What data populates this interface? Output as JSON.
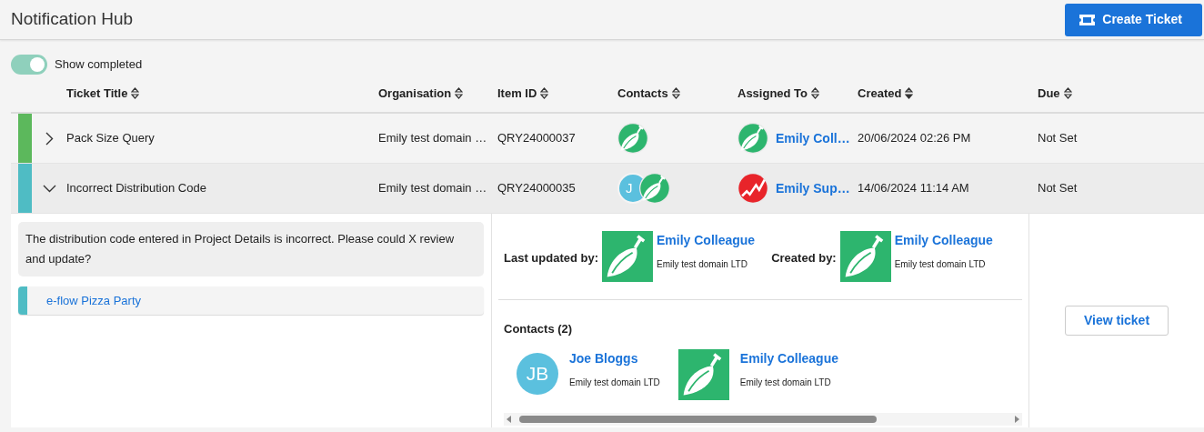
{
  "header": {
    "title": "Notification Hub",
    "create_button": "Create Ticket"
  },
  "toggle": {
    "label": "Show completed",
    "on": true
  },
  "table": {
    "columns": [
      {
        "label": "Ticket Title",
        "sorted": false
      },
      {
        "label": "Organisation",
        "sorted": false
      },
      {
        "label": "Item ID",
        "sorted": false
      },
      {
        "label": "Contacts",
        "sorted": false
      },
      {
        "label": "Assigned To",
        "sorted": false
      },
      {
        "label": "Created",
        "sorted": true
      },
      {
        "label": "Due",
        "sorted": false
      }
    ],
    "rows": [
      {
        "color": "#5cb85c",
        "expanded": false,
        "title": "Pack Size Query",
        "organisation": "Emily test domain …",
        "item_id": "QRY24000037",
        "contacts": [
          {
            "kind": "leaf"
          }
        ],
        "assigned": {
          "kind": "leaf",
          "name": "Emily Coll…"
        },
        "created": "20/06/2024 02:26 PM",
        "due": "Not Set"
      },
      {
        "color": "#4fbcc4",
        "expanded": true,
        "title": "Incorrect Distribution Code",
        "organisation": "Emily test domain …",
        "item_id": "QRY24000035",
        "contacts": [
          {
            "kind": "initials",
            "initials": "J"
          },
          {
            "kind": "leaf"
          }
        ],
        "assigned": {
          "kind": "chart",
          "name": "Emily Sup…"
        },
        "created": "14/06/2024 11:14 AM",
        "due": "Not Set"
      }
    ]
  },
  "detail": {
    "description": "The distribution code entered in Project Details is incorrect. Please could X review and update?",
    "linked_item": {
      "label": "e-flow Pizza Party",
      "color": "#4fbcc4"
    },
    "people": [
      {
        "label": "Last updated by:",
        "name": "Emily Colleague",
        "organisation": "Emily test domain LTD",
        "kind": "leaf"
      },
      {
        "label": "Created by:",
        "name": "Emily Colleague",
        "organisation": "Emily test domain LTD",
        "kind": "leaf"
      }
    ],
    "contacts_heading": "Contacts (2)",
    "contacts": [
      {
        "kind": "initials",
        "initials": "JB",
        "name": "Joe Bloggs",
        "organisation": "Emily test domain LTD"
      },
      {
        "kind": "leaf",
        "name": "Emily Colleague",
        "organisation": "Emily test domain LTD"
      }
    ],
    "view_button": "View ticket"
  }
}
